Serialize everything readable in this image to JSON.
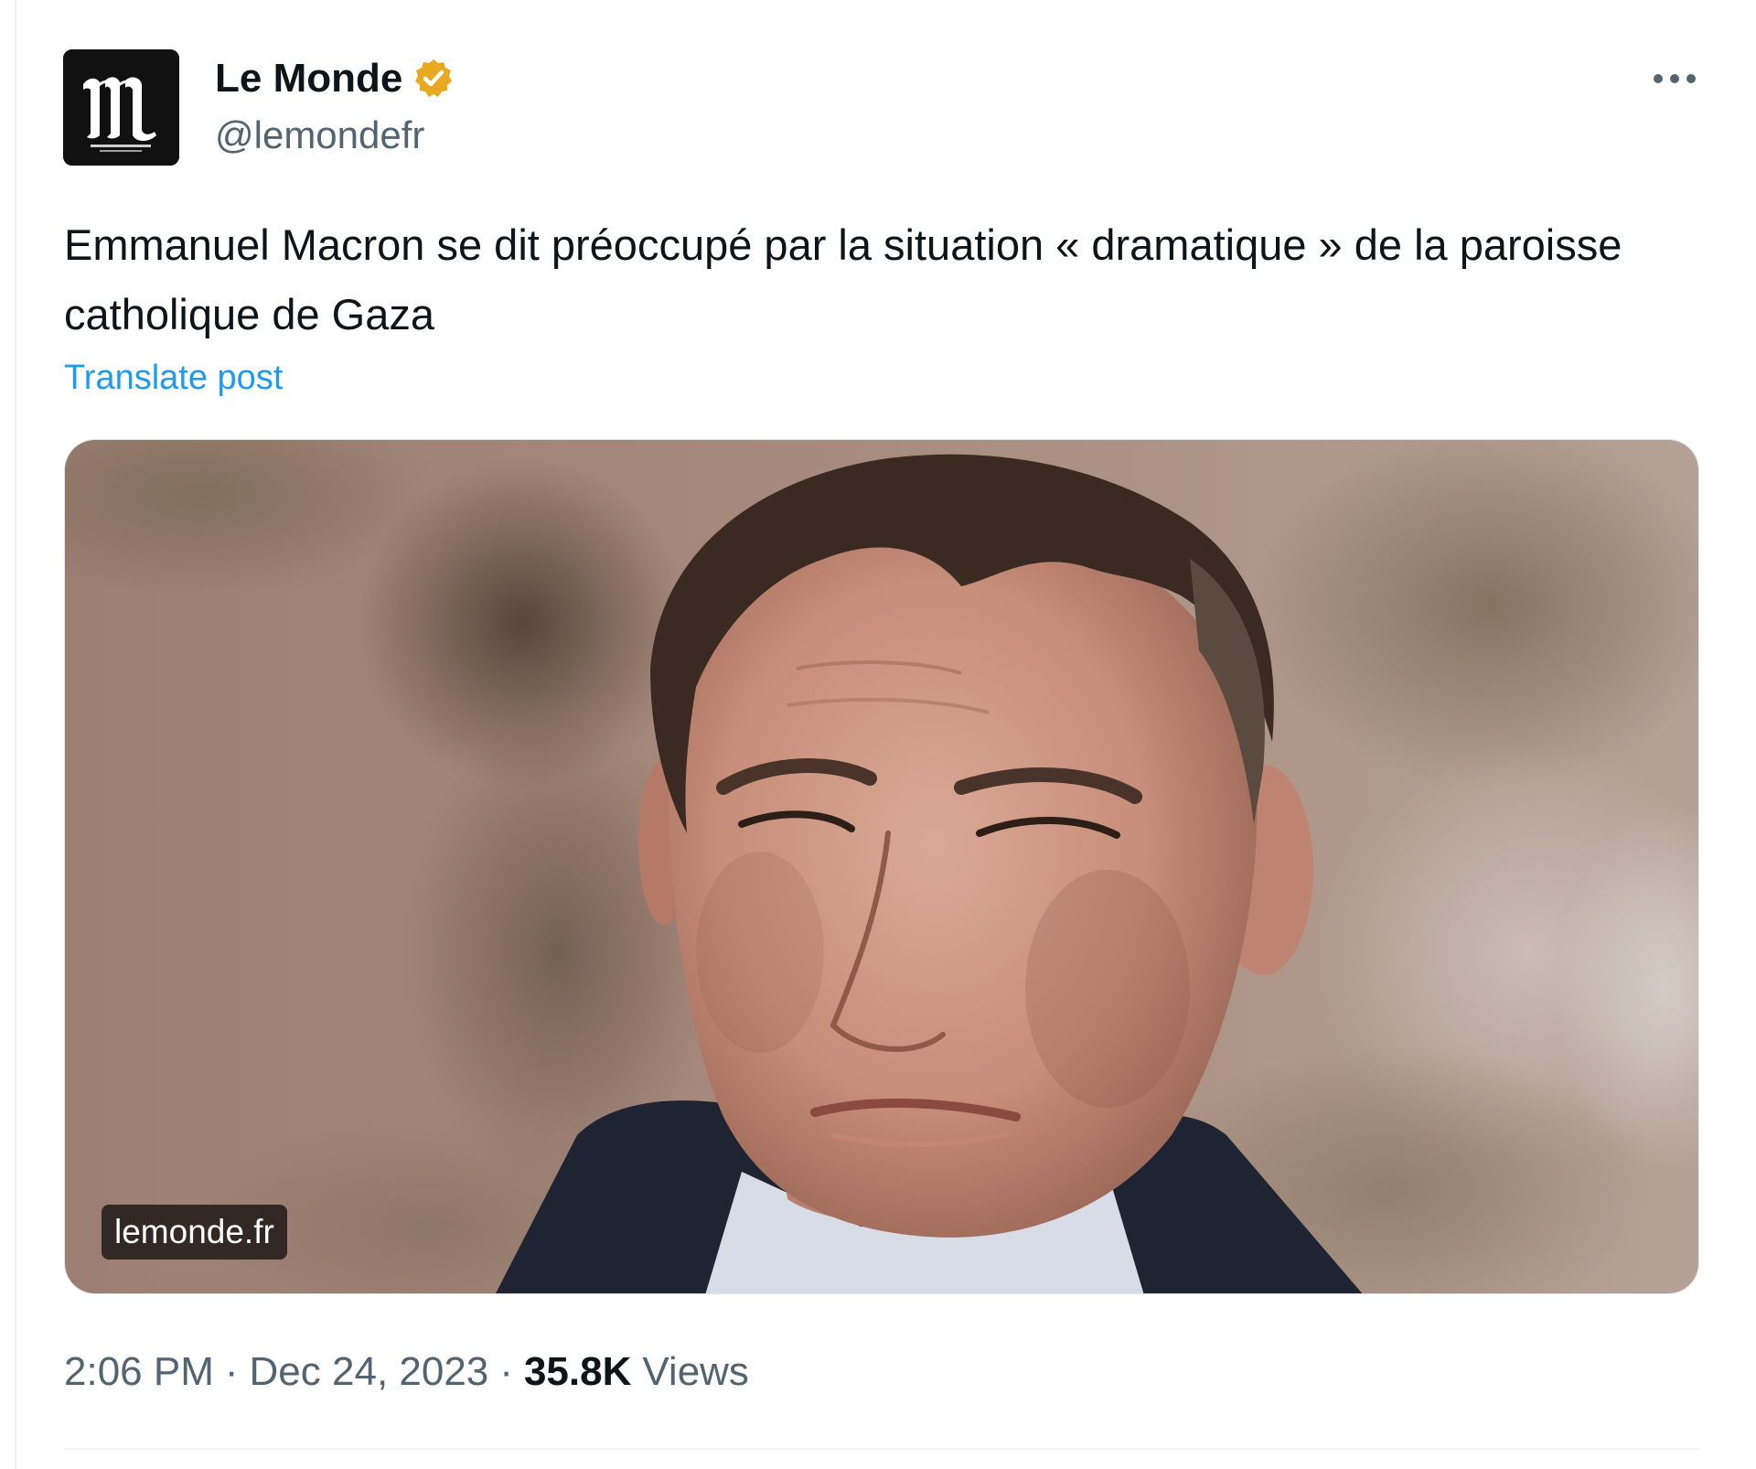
{
  "account": {
    "display_name": "Le Monde",
    "handle": "@lemondefr",
    "avatar_icon": "le-monde-logo-icon",
    "verified_icon": "verified-badge-icon",
    "verified_color": "#e8a81f"
  },
  "post": {
    "text": "Emmanuel Macron se dit préoccupé par la situation « dramatique » de la paroisse catholique de Gaza",
    "translate_label": "Translate post",
    "more_icon": "more-options-icon"
  },
  "media": {
    "domain_label": "lemonde.fr"
  },
  "meta": {
    "time": "2:06 PM",
    "separator": "·",
    "date": "Dec 24, 2023",
    "views_count": "35.8K",
    "views_label": "Views"
  },
  "colors": {
    "text_primary": "#0f1419",
    "text_secondary": "#536471",
    "link": "#1d9bf0"
  }
}
